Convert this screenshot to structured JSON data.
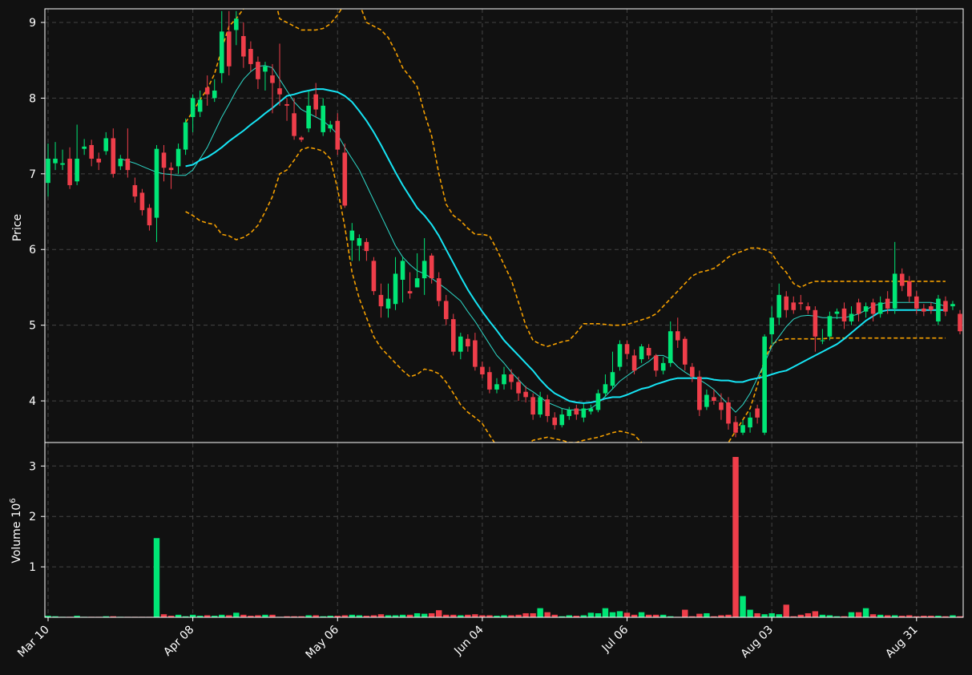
{
  "chart_data": {
    "type": "candlestick",
    "title": "",
    "colors": {
      "background": "#111111",
      "up": "#00e676",
      "down": "#ef3e4a",
      "grid": "#444444",
      "ma_fast": "#2ed9c8",
      "ma_slow": "#16e4f4",
      "bands": "#f5a000",
      "axis": "#ffffff"
    },
    "price_panel": {
      "ylabel": "Price",
      "ylim": [
        3.45,
        9.18
      ],
      "yticks": [
        4,
        5,
        6,
        7,
        8,
        9
      ],
      "grid": true
    },
    "volume_panel": {
      "ylabel": "Volume",
      "yexponent": "6",
      "ylim": [
        0,
        3.45
      ],
      "yticks": [
        1,
        2,
        3
      ],
      "grid": true
    },
    "x_ticks": [
      {
        "label": "Mar 10",
        "index": 0
      },
      {
        "label": "Apr 08",
        "index": 20
      },
      {
        "label": "May 06",
        "index": 40
      },
      {
        "label": "Jun 04",
        "index": 60
      },
      {
        "label": "Jul 06",
        "index": 80
      },
      {
        "label": "Aug 03",
        "index": 100
      },
      {
        "label": "Aug 31",
        "index": 120
      }
    ],
    "candle_count": 127,
    "candles": [
      [
        6.88,
        7.2,
        6.7,
        7.4
      ],
      [
        7.14,
        7.2,
        7.05,
        7.42
      ],
      [
        7.12,
        7.14,
        7.05,
        7.32
      ],
      [
        7.2,
        6.85,
        6.8,
        7.35
      ],
      [
        6.9,
        7.2,
        6.85,
        7.65
      ],
      [
        7.33,
        7.36,
        7.25,
        7.46
      ],
      [
        7.38,
        7.2,
        7.1,
        7.45
      ],
      [
        7.2,
        7.15,
        7.05,
        7.28
      ],
      [
        7.3,
        7.47,
        7.25,
        7.55
      ],
      [
        7.47,
        7.0,
        6.95,
        7.6
      ],
      [
        7.1,
        7.2,
        7.05,
        7.25
      ],
      [
        7.2,
        7.05,
        6.95,
        7.6
      ],
      [
        6.85,
        6.7,
        6.62,
        6.95
      ],
      [
        6.75,
        6.52,
        6.45,
        6.8
      ],
      [
        6.55,
        6.32,
        6.25,
        6.6
      ],
      [
        6.42,
        7.33,
        6.1,
        7.38
      ],
      [
        7.28,
        7.08,
        6.9,
        7.38
      ],
      [
        7.08,
        7.05,
        6.8,
        7.15
      ],
      [
        7.1,
        7.33,
        7.0,
        7.4
      ],
      [
        7.32,
        7.68,
        7.25,
        7.73
      ],
      [
        7.75,
        8.0,
        7.55,
        8.05
      ],
      [
        7.82,
        7.98,
        7.75,
        8.1
      ],
      [
        8.14,
        8.05,
        7.9,
        8.3
      ],
      [
        8.0,
        8.1,
        7.95,
        8.25
      ],
      [
        8.33,
        8.88,
        8.2,
        9.15
      ],
      [
        8.88,
        8.42,
        8.3,
        9.15
      ],
      [
        8.9,
        9.05,
        8.7,
        9.15
      ],
      [
        8.82,
        8.55,
        8.4,
        9.0
      ],
      [
        8.65,
        8.45,
        8.35,
        8.75
      ],
      [
        8.48,
        8.25,
        8.12,
        8.55
      ],
      [
        8.35,
        8.42,
        8.1,
        8.48
      ],
      [
        8.3,
        8.2,
        7.8,
        8.45
      ],
      [
        8.13,
        8.05,
        7.9,
        8.72
      ],
      [
        7.92,
        7.9,
        7.7,
        8.0
      ],
      [
        7.8,
        7.5,
        7.45,
        8.0
      ],
      [
        7.48,
        7.45,
        7.42,
        7.5
      ],
      [
        7.6,
        7.9,
        7.55,
        8.1
      ],
      [
        8.05,
        7.85,
        7.75,
        8.2
      ],
      [
        7.55,
        7.9,
        7.5,
        8.0
      ],
      [
        7.6,
        7.65,
        7.55,
        7.7
      ],
      [
        7.7,
        7.32,
        7.25,
        7.8
      ],
      [
        7.28,
        6.58,
        6.55,
        7.4
      ],
      [
        6.12,
        6.25,
        5.85,
        6.35
      ],
      [
        6.05,
        6.15,
        5.85,
        6.2
      ],
      [
        6.1,
        5.98,
        5.85,
        6.15
      ],
      [
        5.85,
        5.45,
        5.4,
        5.9
      ],
      [
        5.4,
        5.25,
        5.1,
        5.55
      ],
      [
        5.22,
        5.35,
        5.1,
        5.55
      ],
      [
        5.28,
        5.68,
        5.2,
        5.9
      ],
      [
        5.6,
        5.85,
        5.3,
        5.9
      ],
      [
        5.45,
        5.42,
        5.35,
        5.7
      ],
      [
        5.5,
        5.62,
        5.5,
        5.95
      ],
      [
        5.62,
        5.85,
        5.4,
        6.15
      ],
      [
        5.92,
        5.62,
        5.55,
        5.95
      ],
      [
        5.62,
        5.32,
        5.25,
        5.7
      ],
      [
        5.32,
        5.08,
        5.0,
        5.4
      ],
      [
        5.08,
        4.65,
        4.6,
        5.15
      ],
      [
        4.65,
        4.85,
        4.55,
        4.9
      ],
      [
        4.82,
        4.72,
        4.65,
        4.88
      ],
      [
        4.8,
        4.45,
        4.4,
        4.9
      ],
      [
        4.45,
        4.35,
        4.3,
        4.52
      ],
      [
        4.38,
        4.15,
        4.1,
        4.45
      ],
      [
        4.15,
        4.22,
        4.1,
        4.3
      ],
      [
        4.22,
        4.35,
        4.15,
        4.45
      ],
      [
        4.35,
        4.25,
        4.15,
        4.42
      ],
      [
        4.25,
        4.1,
        4.0,
        4.32
      ],
      [
        4.12,
        4.05,
        3.98,
        4.2
      ],
      [
        4.05,
        3.82,
        3.75,
        4.1
      ],
      [
        3.82,
        4.05,
        3.78,
        4.12
      ],
      [
        4.02,
        3.8,
        3.72,
        4.08
      ],
      [
        3.78,
        3.68,
        3.62,
        3.85
      ],
      [
        3.68,
        3.82,
        3.65,
        3.9
      ],
      [
        3.8,
        3.88,
        3.75,
        3.92
      ],
      [
        3.9,
        3.82,
        3.75,
        3.95
      ],
      [
        3.78,
        3.9,
        3.72,
        3.96
      ],
      [
        3.86,
        3.9,
        3.82,
        3.95
      ],
      [
        3.88,
        4.1,
        3.85,
        4.15
      ],
      [
        4.1,
        4.22,
        4.05,
        4.35
      ],
      [
        4.2,
        4.38,
        4.15,
        4.65
      ],
      [
        4.45,
        4.75,
        4.4,
        4.8
      ],
      [
        4.75,
        4.62,
        4.55,
        4.8
      ],
      [
        4.6,
        4.4,
        4.35,
        4.68
      ],
      [
        4.55,
        4.72,
        4.5,
        4.75
      ],
      [
        4.7,
        4.6,
        4.55,
        4.75
      ],
      [
        4.6,
        4.4,
        4.32,
        4.62
      ],
      [
        4.4,
        4.5,
        4.35,
        4.58
      ],
      [
        4.5,
        4.92,
        4.45,
        5.05
      ],
      [
        4.92,
        4.8,
        4.7,
        5.1
      ],
      [
        4.82,
        4.48,
        4.4,
        4.85
      ],
      [
        4.45,
        4.32,
        4.25,
        4.5
      ],
      [
        4.32,
        3.88,
        3.8,
        4.4
      ],
      [
        3.92,
        4.08,
        3.88,
        4.15
      ],
      [
        4.05,
        4.0,
        3.95,
        4.15
      ],
      [
        3.98,
        3.88,
        3.75,
        4.1
      ],
      [
        3.98,
        3.7,
        3.62,
        4.05
      ],
      [
        3.72,
        3.58,
        3.52,
        3.8
      ],
      [
        3.58,
        3.68,
        3.55,
        3.75
      ],
      [
        3.65,
        3.78,
        3.58,
        3.85
      ],
      [
        3.9,
        3.78,
        3.7,
        3.95
      ],
      [
        3.58,
        4.85,
        3.55,
        4.88
      ],
      [
        4.88,
        5.1,
        4.75,
        5.25
      ],
      [
        5.1,
        5.4,
        5.0,
        5.55
      ],
      [
        5.38,
        5.2,
        5.1,
        5.45
      ],
      [
        5.3,
        5.2,
        5.15,
        5.38
      ],
      [
        5.3,
        5.28,
        5.2,
        5.4
      ],
      [
        5.25,
        5.2,
        5.15,
        5.3
      ],
      [
        5.2,
        4.85,
        4.65,
        5.25
      ],
      [
        4.8,
        4.8,
        4.75,
        4.95
      ],
      [
        4.85,
        5.12,
        4.8,
        5.18
      ],
      [
        5.15,
        5.18,
        5.08,
        5.22
      ],
      [
        5.22,
        5.05,
        4.95,
        5.3
      ],
      [
        5.05,
        5.15,
        5.0,
        5.25
      ],
      [
        5.3,
        5.15,
        5.05,
        5.35
      ],
      [
        5.18,
        5.25,
        5.1,
        5.3
      ],
      [
        5.3,
        5.15,
        5.05,
        5.35
      ],
      [
        5.15,
        5.3,
        5.1,
        5.38
      ],
      [
        5.35,
        5.22,
        5.15,
        5.45
      ],
      [
        5.22,
        5.68,
        5.15,
        6.1
      ],
      [
        5.68,
        5.52,
        5.45,
        5.75
      ],
      [
        5.58,
        5.38,
        5.3,
        5.65
      ],
      [
        5.38,
        5.22,
        5.15,
        5.45
      ],
      [
        5.22,
        5.18,
        5.12,
        5.28
      ],
      [
        5.25,
        5.2,
        5.15,
        5.3
      ],
      [
        5.05,
        5.35,
        5.0,
        5.4
      ],
      [
        5.32,
        5.18,
        5.12,
        5.38
      ],
      [
        5.25,
        5.28,
        5.2,
        5.32
      ],
      [
        5.15,
        4.92,
        4.88,
        5.2
      ]
    ],
    "volume": [
      0.03,
      0.02,
      0.01,
      0.01,
      0.03,
      0.01,
      0.01,
      0.01,
      0.02,
      0.02,
      0.01,
      0.01,
      0.01,
      0.01,
      0.01,
      1.57,
      0.06,
      0.03,
      0.05,
      0.02,
      0.05,
      0.03,
      0.04,
      0.03,
      0.05,
      0.04,
      0.09,
      0.05,
      0.03,
      0.04,
      0.05,
      0.05,
      0.01,
      0.02,
      0.02,
      0.02,
      0.04,
      0.04,
      0.02,
      0.03,
      0.03,
      0.04,
      0.05,
      0.04,
      0.03,
      0.04,
      0.06,
      0.04,
      0.04,
      0.05,
      0.05,
      0.08,
      0.07,
      0.08,
      0.14,
      0.05,
      0.05,
      0.04,
      0.05,
      0.06,
      0.04,
      0.04,
      0.03,
      0.04,
      0.04,
      0.05,
      0.08,
      0.08,
      0.18,
      0.1,
      0.05,
      0.02,
      0.04,
      0.03,
      0.04,
      0.09,
      0.08,
      0.18,
      0.1,
      0.12,
      0.09,
      0.05,
      0.1,
      0.05,
      0.05,
      0.05,
      0.02,
      0.01,
      0.15,
      0.02,
      0.07,
      0.08,
      0.02,
      0.04,
      0.05,
      3.18,
      0.42,
      0.15,
      0.08,
      0.06,
      0.08,
      0.06,
      0.25,
      0.02,
      0.05,
      0.08,
      0.12,
      0.05,
      0.04,
      0.02,
      0.02,
      0.1,
      0.1,
      0.18,
      0.06,
      0.05,
      0.04,
      0.04,
      0.03,
      0.04,
      0.02,
      0.03,
      0.03,
      0.03,
      0.02,
      0.04,
      0.02
    ],
    "ma_fast": [
      null,
      null,
      null,
      null,
      null,
      null,
      null,
      null,
      null,
      null,
      7.2,
      7.17,
      7.14,
      7.1,
      7.06,
      7.02,
      7.0,
      6.99,
      6.98,
      6.98,
      7.05,
      7.2,
      7.35,
      7.55,
      7.75,
      7.92,
      8.1,
      8.25,
      8.35,
      8.42,
      8.43,
      8.4,
      8.25,
      8.1,
      7.95,
      7.85,
      7.8,
      7.75,
      7.7,
      7.62,
      7.52,
      7.35,
      7.2,
      7.05,
      6.85,
      6.65,
      6.45,
      6.25,
      6.05,
      5.9,
      5.8,
      5.72,
      5.68,
      5.62,
      5.55,
      5.48,
      5.4,
      5.32,
      5.18,
      5.05,
      4.9,
      4.75,
      4.6,
      4.5,
      4.38,
      4.28,
      4.18,
      4.12,
      4.05,
      3.98,
      3.94,
      3.9,
      3.88,
      3.88,
      3.88,
      3.9,
      3.97,
      4.06,
      4.16,
      4.26,
      4.33,
      4.4,
      4.46,
      4.52,
      4.6,
      4.6,
      4.55,
      4.45,
      4.38,
      4.32,
      4.28,
      4.22,
      4.15,
      4.05,
      3.95,
      3.85,
      3.95,
      4.1,
      4.3,
      4.5,
      4.72,
      4.85,
      4.98,
      5.08,
      5.12,
      5.13,
      5.12,
      5.1,
      5.1,
      5.1,
      5.1,
      5.12,
      5.15,
      5.2,
      5.26,
      5.28,
      5.3,
      5.3,
      5.3,
      5.3,
      5.3,
      5.3,
      5.3,
      5.28,
      5.25
    ],
    "ma_slow": [
      null,
      null,
      null,
      null,
      null,
      null,
      null,
      null,
      null,
      null,
      null,
      null,
      null,
      null,
      null,
      null,
      null,
      null,
      null,
      7.1,
      7.12,
      7.18,
      7.22,
      7.28,
      7.35,
      7.43,
      7.5,
      7.57,
      7.65,
      7.72,
      7.8,
      7.87,
      7.95,
      8.03,
      8.05,
      8.08,
      8.1,
      8.12,
      8.12,
      8.1,
      8.08,
      8.03,
      7.95,
      7.83,
      7.7,
      7.55,
      7.38,
      7.2,
      7.02,
      6.85,
      6.7,
      6.55,
      6.45,
      6.33,
      6.18,
      6.0,
      5.82,
      5.64,
      5.47,
      5.32,
      5.18,
      5.05,
      4.93,
      4.8,
      4.7,
      4.6,
      4.5,
      4.4,
      4.28,
      4.18,
      4.1,
      4.05,
      4.0,
      3.98,
      3.97,
      3.98,
      4.0,
      4.03,
      4.05,
      4.05,
      4.08,
      4.12,
      4.16,
      4.18,
      4.22,
      4.25,
      4.28,
      4.3,
      4.3,
      4.3,
      4.3,
      4.3,
      4.28,
      4.27,
      4.27,
      4.25,
      4.25,
      4.28,
      4.3,
      4.32,
      4.35,
      4.38,
      4.4,
      4.45,
      4.5,
      4.55,
      4.6,
      4.65,
      4.7,
      4.75,
      4.82,
      4.9,
      4.98,
      5.06,
      5.12,
      5.18,
      5.2,
      5.2,
      5.2,
      5.2,
      5.2,
      5.2,
      5.2,
      5.2,
      5.2
    ],
    "upper_band": [
      null,
      null,
      null,
      null,
      null,
      null,
      null,
      null,
      null,
      null,
      null,
      null,
      null,
      null,
      null,
      null,
      null,
      null,
      null,
      7.68,
      7.82,
      7.98,
      8.12,
      8.32,
      8.65,
      8.95,
      9.05,
      9.18,
      9.4,
      9.6,
      9.7,
      9.45,
      9.05,
      9.0,
      8.95,
      8.9,
      8.9,
      8.9,
      8.92,
      8.98,
      9.1,
      9.25,
      9.4,
      9.25,
      9.0,
      8.95,
      8.9,
      8.8,
      8.62,
      8.4,
      8.28,
      8.15,
      7.8,
      7.5,
      7.0,
      6.6,
      6.45,
      6.38,
      6.28,
      6.2,
      6.2,
      6.18,
      6.0,
      5.8,
      5.6,
      5.3,
      5.0,
      4.8,
      4.75,
      4.72,
      4.75,
      4.78,
      4.8,
      4.9,
      5.02,
      5.02,
      5.02,
      5.01,
      5.0,
      5.0,
      5.01,
      5.04,
      5.07,
      5.1,
      5.15,
      5.25,
      5.35,
      5.45,
      5.55,
      5.65,
      5.7,
      5.72,
      5.75,
      5.82,
      5.9,
      5.95,
      5.98,
      6.02,
      6.02,
      6.0,
      5.95,
      5.8,
      5.7,
      5.55,
      5.5,
      5.55,
      5.58,
      5.58,
      5.58,
      5.58,
      5.58,
      5.58,
      5.58,
      5.58,
      5.58,
      5.58,
      5.58,
      5.58,
      5.58,
      5.58,
      5.58,
      5.58,
      5.58,
      5.58,
      5.58
    ],
    "lower_band": [
      null,
      null,
      null,
      null,
      null,
      null,
      null,
      null,
      null,
      null,
      null,
      null,
      null,
      null,
      null,
      null,
      null,
      null,
      null,
      6.5,
      6.45,
      6.38,
      6.35,
      6.33,
      6.2,
      6.18,
      6.13,
      6.16,
      6.22,
      6.32,
      6.5,
      6.7,
      7.0,
      7.05,
      7.18,
      7.32,
      7.35,
      7.33,
      7.3,
      7.2,
      6.8,
      6.3,
      5.7,
      5.35,
      5.1,
      4.85,
      4.7,
      4.6,
      4.5,
      4.4,
      4.32,
      4.35,
      4.42,
      4.4,
      4.36,
      4.25,
      4.1,
      3.95,
      3.85,
      3.78,
      3.7,
      3.55,
      3.4,
      3.3,
      3.2,
      3.3,
      3.4,
      3.48,
      3.5,
      3.52,
      3.5,
      3.48,
      3.45,
      3.45,
      3.48,
      3.5,
      3.52,
      3.55,
      3.58,
      3.6,
      3.58,
      3.55,
      3.45,
      3.3,
      3.2,
      3.15,
      3.12,
      3.1,
      3.1,
      3.12,
      3.15,
      3.2,
      3.25,
      3.3,
      3.45,
      3.6,
      3.75,
      3.9,
      4.2,
      4.55,
      4.75,
      4.8,
      4.82,
      4.82,
      4.82,
      4.82,
      4.82,
      4.82,
      4.83,
      4.83,
      4.83,
      4.83,
      4.83,
      4.83,
      4.83,
      4.83,
      4.83,
      4.83,
      4.83,
      4.83,
      4.83,
      4.83,
      4.83,
      4.83,
      4.83
    ]
  }
}
